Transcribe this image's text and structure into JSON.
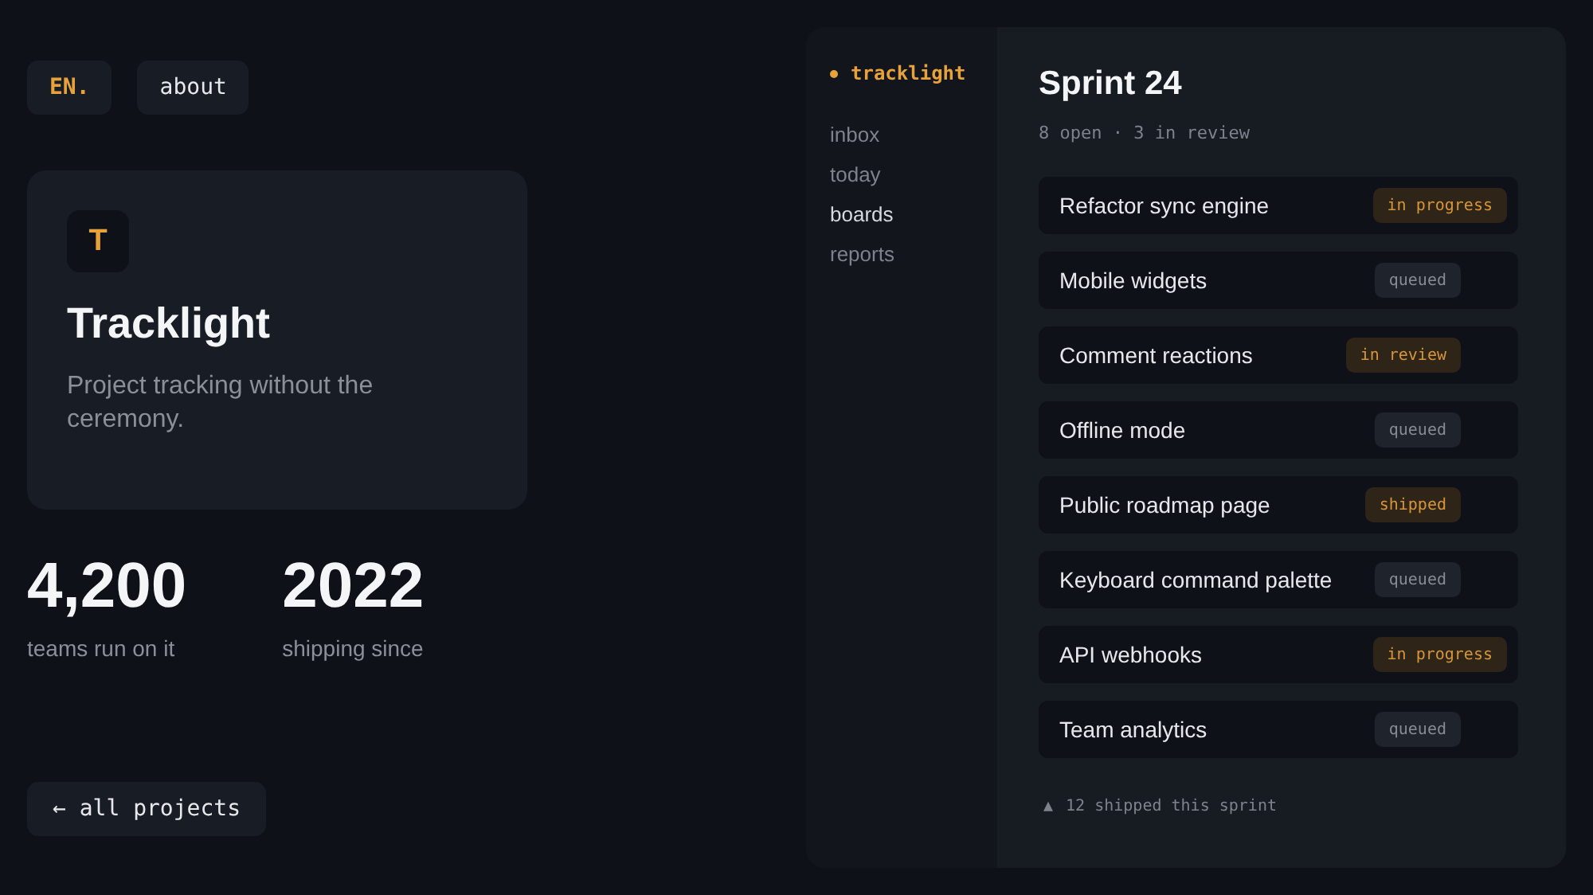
{
  "header": {
    "lang_button": "EN.",
    "about_button": "about"
  },
  "product": {
    "logo_letter": "T",
    "name": "Tracklight",
    "tagline": "Project tracking without the ceremony."
  },
  "stats": [
    {
      "value": "4,200",
      "label": "teams run on it"
    },
    {
      "value": "2022",
      "label": "shipping since"
    }
  ],
  "back_button": "← all projects",
  "sidebar": {
    "brand": "tracklight",
    "items": [
      {
        "label": "inbox",
        "selected": false
      },
      {
        "label": "today",
        "selected": false
      },
      {
        "label": "boards",
        "selected": true
      },
      {
        "label": "reports",
        "selected": false
      }
    ]
  },
  "board": {
    "title": "Sprint 24",
    "subtitle": "8 open · 3 in review",
    "tasks": [
      {
        "title": "Refactor sync engine",
        "status": "in progress",
        "kind": "warm"
      },
      {
        "title": "Mobile widgets",
        "status": "queued",
        "kind": "muted"
      },
      {
        "title": "Comment reactions",
        "status": "in review",
        "kind": "warm"
      },
      {
        "title": "Offline mode",
        "status": "queued",
        "kind": "muted"
      },
      {
        "title": "Public roadmap page",
        "status": "shipped",
        "kind": "warm"
      },
      {
        "title": "Keyboard command palette",
        "status": "queued",
        "kind": "muted"
      },
      {
        "title": "API webhooks",
        "status": "in progress",
        "kind": "warm"
      },
      {
        "title": "Team analytics",
        "status": "queued",
        "kind": "muted"
      }
    ],
    "footer_mark": "▲",
    "footer": "12 shipped this sprint"
  }
}
